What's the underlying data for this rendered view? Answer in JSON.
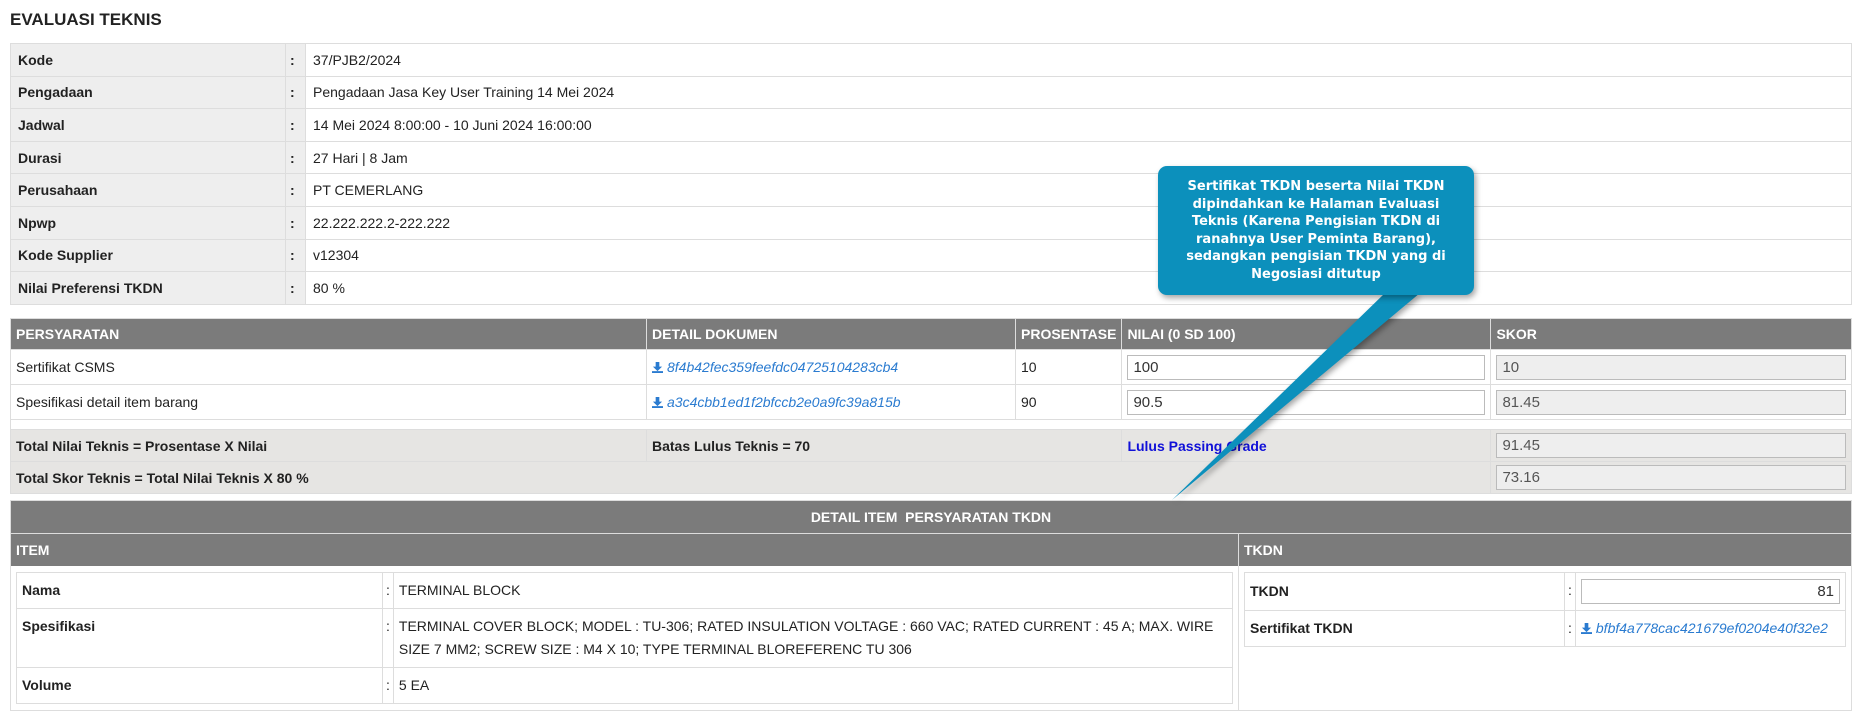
{
  "title": "EVALUASI TEKNIS",
  "info": [
    {
      "label": "Kode",
      "value": "37/PJB2/2024"
    },
    {
      "label": "Pengadaan",
      "value": "Pengadaan Jasa Key User Training 14 Mei 2024"
    },
    {
      "label": "Jadwal",
      "value": "14 Mei 2024 8:00:00 - 10 Juni 2024 16:00:00"
    },
    {
      "label": "Durasi",
      "value": "27 Hari | 8 Jam"
    },
    {
      "label": "Perusahaan",
      "value": "PT CEMERLANG"
    },
    {
      "label": "Npwp",
      "value": "22.222.222.2-222.222"
    },
    {
      "label": "Kode Supplier",
      "value": "v12304"
    },
    {
      "label": "Nilai Preferensi TKDN",
      "value": "80 %"
    }
  ],
  "colon": ":",
  "req": {
    "headers": [
      "PERSYARATAN",
      "DETAIL DOKUMEN",
      "PROSENTASE",
      "NILAI (0 SD 100)",
      "SKOR"
    ],
    "rows": [
      {
        "name": "Sertifikat CSMS",
        "doc": "8f4b42fec359feefdc04725104283cb4",
        "pct": "10",
        "nilai": "100",
        "skor": "10"
      },
      {
        "name": "Spesifikasi detail item barang",
        "doc": "a3c4cbb1ed1f2bfccb2e0a9fc39a815b",
        "pct": "90",
        "nilai": "90.5",
        "skor": "81.45"
      }
    ],
    "total_nilai_label": "Total Nilai Teknis = Prosentase X Nilai",
    "batas_label": "Batas Lulus Teknis = 70",
    "status": "Lulus Passing Grade",
    "total_nilai": "91.45",
    "total_skor_label": "Total Skor Teknis = Total Nilai Teknis X 80 %",
    "total_skor": "73.16"
  },
  "detail": {
    "title": "DETAIL ITEM  PERSYARATAN TKDN",
    "item_header": "ITEM",
    "tkdn_header": "TKDN",
    "items": [
      {
        "label": "Nama",
        "value": "TERMINAL BLOCK"
      },
      {
        "label": "Spesifikasi",
        "value": "TERMINAL COVER BLOCK; MODEL : TU-306; RATED INSULATION VOLTAGE : 660 VAC; RATED CURRENT : 45 A; MAX. WIRE SIZE 7 MM2; SCREW SIZE : M4 X 10; TYPE TERMINAL BLOREFERENC TU 306"
      },
      {
        "label": "Volume",
        "value": "5 EA"
      }
    ],
    "tkdn_label": "TKDN",
    "tkdn_value": "81",
    "sertifikat_label": "Sertifikat TKDN",
    "sertifikat_doc": "bfbf4a778cac421679ef0204e40f32e2"
  },
  "callout": "Sertifikat TKDN beserta Nilai TKDN dipindahkan ke Halaman Evaluasi Teknis (Karena Pengisian TKDN di ranahnya User Peminta Barang), sedangkan pengisian TKDN yang di Negosiasi ditutup",
  "colors": {
    "header": "#7b7b7b",
    "link": "#2a7bd0",
    "callout": "#0c90bc",
    "pass": "#1010d8"
  }
}
